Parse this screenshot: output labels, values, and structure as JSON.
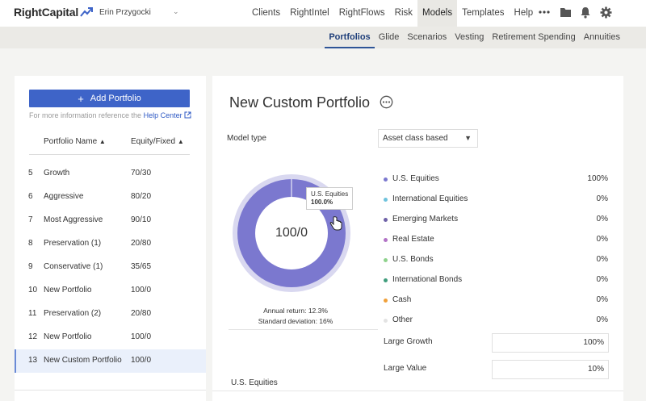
{
  "app": {
    "logo_text": "RightCapital",
    "user_name": "Erin Przygocki"
  },
  "nav": [
    "Clients",
    "RightIntel",
    "RightFlows",
    "Risk",
    "Models",
    "Templates",
    "Help"
  ],
  "nav_active": "Models",
  "subnav": [
    "Portfolios",
    "Glide",
    "Scenarios",
    "Vesting",
    "Retirement Spending",
    "Annuities"
  ],
  "subnav_active": "Portfolios",
  "left": {
    "add_button": "Add Portfolio",
    "help_text": "For more information reference the",
    "help_link": "Help Center",
    "col_name": "Portfolio Name",
    "col_equity": "Equity/Fixed",
    "rows": [
      {
        "num": "5",
        "name": "Growth",
        "ratio": "70/30"
      },
      {
        "num": "6",
        "name": "Aggressive",
        "ratio": "80/20"
      },
      {
        "num": "7",
        "name": "Most Aggressive",
        "ratio": "90/10"
      },
      {
        "num": "8",
        "name": "Preservation (1)",
        "ratio": "20/80"
      },
      {
        "num": "9",
        "name": "Conservative (1)",
        "ratio": "35/65"
      },
      {
        "num": "10",
        "name": "New Portfolio",
        "ratio": "100/0"
      },
      {
        "num": "11",
        "name": "Preservation (2)",
        "ratio": "20/80"
      },
      {
        "num": "12",
        "name": "New Portfolio",
        "ratio": "100/0"
      },
      {
        "num": "13",
        "name": "New Custom Portfolio",
        "ratio": "100/0"
      }
    ]
  },
  "main": {
    "title": "New Custom Portfolio",
    "model_type_label": "Model type",
    "model_type_value": "Asset class based",
    "donut_center": "100/0",
    "tooltip_name": "U.S. Equities",
    "tooltip_value": "100.0%",
    "annual_return": "Annual return: 12.3%",
    "std_dev": "Standard deviation: 16%",
    "allocations": [
      {
        "name": "U.S. Equities",
        "value": "100%",
        "color": "#7b78cf"
      },
      {
        "name": "International Equities",
        "value": "0%",
        "color": "#6fc3dd"
      },
      {
        "name": "Emerging Markets",
        "value": "0%",
        "color": "#6f62a8"
      },
      {
        "name": "Real Estate",
        "value": "0%",
        "color": "#b273c6"
      },
      {
        "name": "U.S. Bonds",
        "value": "0%",
        "color": "#8ed28c"
      },
      {
        "name": "International Bonds",
        "value": "0%",
        "color": "#3f9d7c"
      },
      {
        "name": "Cash",
        "value": "0%",
        "color": "#f0a03a"
      },
      {
        "name": "Other",
        "value": "0%",
        "color": "#e3e3e3"
      }
    ],
    "sub_allocations": [
      {
        "name": "Large Growth",
        "value": "100%"
      },
      {
        "name": "Large Value",
        "value": "10%"
      }
    ],
    "section_label": "U.S. Equities"
  },
  "colors": {
    "brand_blue": "#3e64c8",
    "donut_fill": "#7b78cf",
    "donut_ring": "#d9d8f0"
  }
}
